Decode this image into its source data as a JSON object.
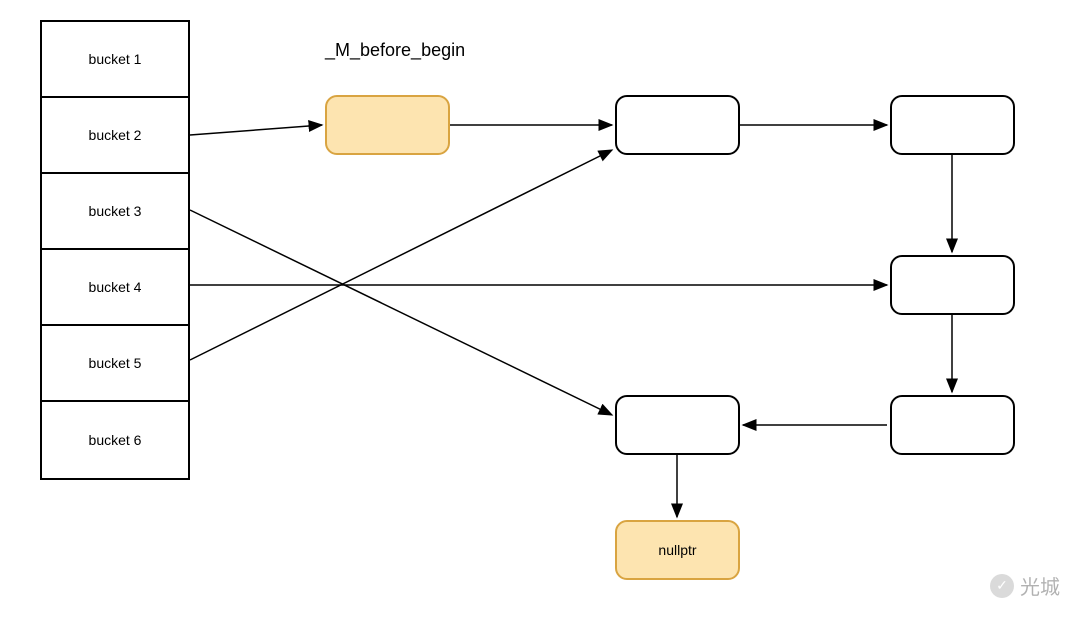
{
  "buckets": {
    "b1": "bucket 1",
    "b2": "bucket 2",
    "b3": "bucket 3",
    "b4": "bucket 4",
    "b5": "bucket 5",
    "b6": "bucket 6"
  },
  "labels": {
    "before_begin": "_M_before_begin",
    "nullptr": "nullptr"
  },
  "watermark": {
    "text": "光城"
  },
  "diagram": {
    "description": "Hash table bucket array pointing into a singly-linked node list",
    "chain": [
      "_M_before_begin",
      "node1",
      "node2",
      "node3",
      "node4",
      "node5",
      "nullptr"
    ],
    "bucket_pointers": {
      "bucket 2": "_M_before_begin",
      "bucket 3": "node5",
      "bucket 4": "node3",
      "bucket 5": "node1"
    }
  }
}
